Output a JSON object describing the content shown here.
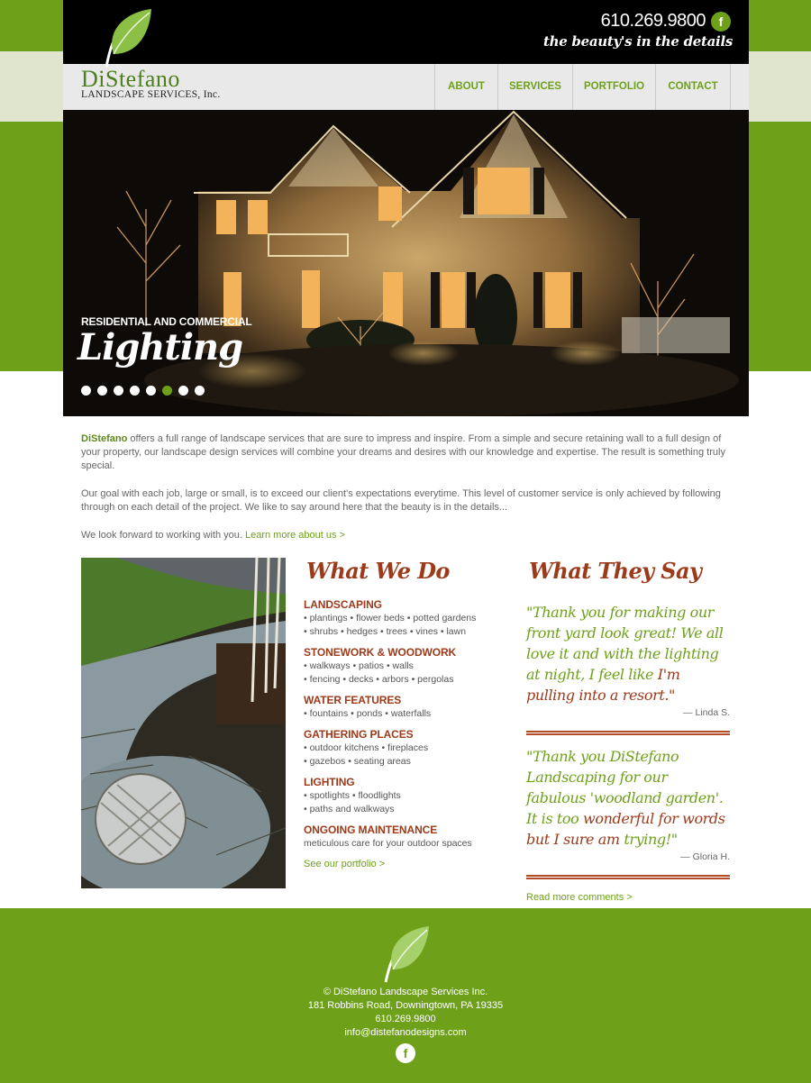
{
  "header": {
    "logo_name": "DiStefano",
    "logo_sub": "LANDSCAPE SERVICES, Inc.",
    "phone": "610.269.9800",
    "tagline": "the beauty's in the details",
    "facebook_glyph": "f"
  },
  "nav": [
    {
      "label": "ABOUT"
    },
    {
      "label": "SERVICES"
    },
    {
      "label": "PORTFOLIO"
    },
    {
      "label": "CONTACT"
    }
  ],
  "hero": {
    "kicker": "RESIDENTIAL AND COMMERCIAL",
    "title": "Lighting",
    "slide_count": 8,
    "active_slide": 5
  },
  "intro": {
    "brand": "DiStefano",
    "p1": " offers a full range of landscape services that are sure to impress and inspire. From a simple and secure retaining wall to a full design of your property, our landscape design services will combine your dreams and desires with our knowledge and expertise. The result is something truly special.",
    "p2": "Our goal with each job, large or small, is to exceed our client's expectations everytime. This level of customer service is only achieved by following through on each detail of the project. We like to say around here that the beauty is in the details...",
    "p3": "We look forward to working with you. ",
    "learn_more": "Learn more about us >"
  },
  "what_we_do": {
    "heading": "What We Do",
    "services": [
      {
        "title": "LANDSCAPING",
        "lines": [
          "• plantings • flower beds • potted gardens",
          "• shrubs • hedges • trees • vines • lawn"
        ]
      },
      {
        "title": "STONEWORK & WOODWORK",
        "lines": [
          "• walkways • patios • walls",
          "• fencing • decks • arbors • pergolas"
        ]
      },
      {
        "title": "WATER FEATURES",
        "lines": [
          "• fountains • ponds • waterfalls"
        ]
      },
      {
        "title": "GATHERING PLACES",
        "lines": [
          "• outdoor kitchens • fireplaces",
          "• gazebos • seating areas"
        ]
      },
      {
        "title": "LIGHTING",
        "lines": [
          "• spotlights • floodlights",
          "• paths and walkways"
        ]
      },
      {
        "title": "ONGOING MAINTENANCE",
        "lines": [
          "meticulous care for your outdoor spaces"
        ]
      }
    ],
    "portfolio_link": "See our portfolio >"
  },
  "what_they_say": {
    "heading": "What They Say",
    "testimonials": [
      {
        "green": "\"Thank you for making our front yard look great! We all love it and with the lighting at night, I feel like ",
        "dark": "I'm pulling into a resort.\"",
        "author": "— Linda S."
      },
      {
        "green": "\"Thank you DiStefano Landscaping for our fabulous 'woodland garden'. It is too ",
        "dark": "wonderful for words but I sure am ",
        "green2": "trying!\"",
        "author": "— Gloria H."
      }
    ],
    "more_link": "Read more comments >"
  },
  "footer": {
    "copyright": "© DiStefano Landscape Services Inc.",
    "address": "181 Robbins Road, Downingtown, PA 19335",
    "phone": "610.269.9800",
    "email": "info@distefanodesigns.com",
    "facebook_glyph": "f"
  },
  "colors": {
    "brand_green": "#6ea01a",
    "accent_rust": "#9c3a1a",
    "pale_band": "#dfe6cd"
  }
}
